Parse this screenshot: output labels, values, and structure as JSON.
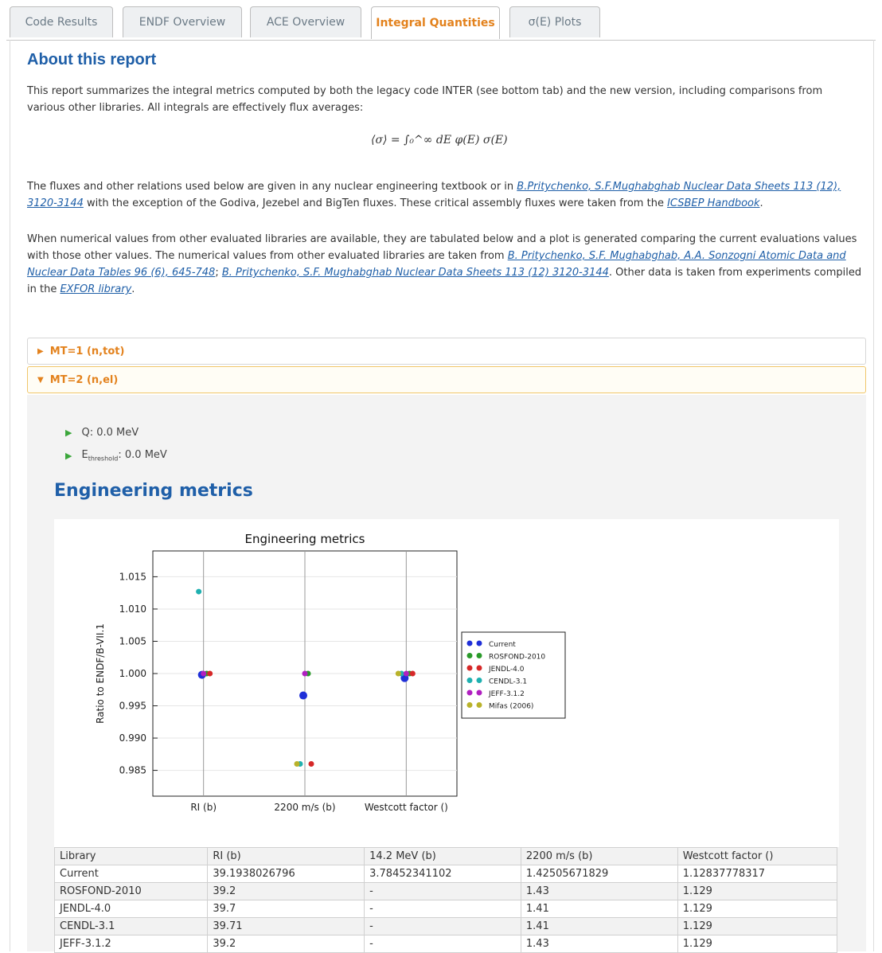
{
  "tabs": [
    {
      "label": "Code Results",
      "active": false
    },
    {
      "label": "ENDF Overview",
      "active": false
    },
    {
      "label": "ACE Overview",
      "active": false
    },
    {
      "label": "Integral Quantities",
      "active": true
    },
    {
      "label": "σ(E) Plots",
      "active": false
    }
  ],
  "about": {
    "title": "About this report",
    "p1": "This report summarizes the integral metrics computed by both the legacy code INTER (see bottom tab) and the new version, including comparisons from various other libraries. All integrals are effectively flux averages:",
    "formula": "⟨σ⟩ = ∫₀^∞ dE φ(E) σ(E)",
    "p2_pre": "The fluxes and other relations used below are given in any nuclear engineering textbook or in ",
    "p2_link1": "B.Pritychenko, S.F.Mughabghab Nuclear Data Sheets 113 (12), 3120-3144",
    "p2_mid": " with the exception of the Godiva, Jezebel and BigTen fluxes. These critical assembly fluxes were taken from the ",
    "p2_link2": "ICSBEP Handbook",
    "p2_end": ".",
    "p3_pre": "When numerical values from other evaluated libraries are available, they are tabulated below and a plot is generated comparing the current evaluations values with those other values. The numerical values from other evaluated libraries are taken from ",
    "p3_link1": "B. Pritychenko, S.F. Mughabghab, A.A. Sonzogni Atomic Data and Nuclear Data Tables 96 (6), 645-748",
    "p3_sep": "; ",
    "p3_link2": "B. Pritychenko, S.F. Mughabghab Nuclear Data Sheets 113 (12) 3120-3144",
    "p3_mid": ". Other data is taken from experiments compiled in the ",
    "p3_link3": "EXFOR library",
    "p3_end": "."
  },
  "accordion": [
    {
      "label": "MT=1 (n,tot)",
      "open": false
    },
    {
      "label": "MT=2 (n,el)",
      "open": true
    }
  ],
  "details": {
    "q_value": "Q: 0.0 MeV",
    "thresh_prefix": "E",
    "thresh_sub": "threshold",
    "thresh_value": ": 0.0 MeV"
  },
  "section_title": "Engineering metrics",
  "chart_data": {
    "type": "scatter",
    "title": "Engineering metrics",
    "ylabel": "Ratio to ENDF/B-VII.1",
    "xlabel": "",
    "categories": [
      "RI (b)",
      "2200 m/s (b)",
      "Westcott factor ()"
    ],
    "ylim": [
      0.981,
      1.019
    ],
    "yticks": [
      0.985,
      0.99,
      0.995,
      1.0,
      1.005,
      1.01,
      1.015
    ],
    "ytick_labels": [
      "0.985",
      "0.990",
      "0.995",
      "1.000",
      "1.005",
      "1.010",
      "1.015"
    ],
    "grid": true,
    "legend_position": "right",
    "series": [
      {
        "name": "Current",
        "color": "#1f2fd8",
        "values": [
          0.9998,
          0.9966,
          0.9993
        ]
      },
      {
        "name": "ROSFOND-2010",
        "color": "#2a9a2a",
        "values": [
          1.0,
          1.0,
          1.0
        ]
      },
      {
        "name": "JENDL-4.0",
        "color": "#d62828",
        "values": [
          1.0,
          0.986,
          1.0
        ]
      },
      {
        "name": "CENDL-3.1",
        "color": "#1fb0b0",
        "values": [
          1.0127,
          0.986,
          1.0
        ]
      },
      {
        "name": "JEFF-3.1.2",
        "color": "#b020c0",
        "values": [
          1.0,
          1.0,
          1.0
        ]
      },
      {
        "name": "Mifas (2006)",
        "color": "#b9b22a",
        "values": [
          null,
          0.986,
          1.0
        ]
      }
    ]
  },
  "table": {
    "headers": [
      "Library",
      "RI (b)",
      "14.2 MeV (b)",
      "2200 m/s (b)",
      "Westcott factor ()"
    ],
    "rows": [
      [
        "Current",
        "39.1938026796",
        "3.78452341102",
        "1.42505671829",
        "1.12837778317"
      ],
      [
        "ROSFOND-2010",
        "39.2",
        "-",
        "1.43",
        "1.129"
      ],
      [
        "JENDL-4.0",
        "39.7",
        "-",
        "1.41",
        "1.129"
      ],
      [
        "CENDL-3.1",
        "39.71",
        "-",
        "1.41",
        "1.129"
      ],
      [
        "JEFF-3.1.2",
        "39.2",
        "-",
        "1.43",
        "1.129"
      ]
    ]
  }
}
